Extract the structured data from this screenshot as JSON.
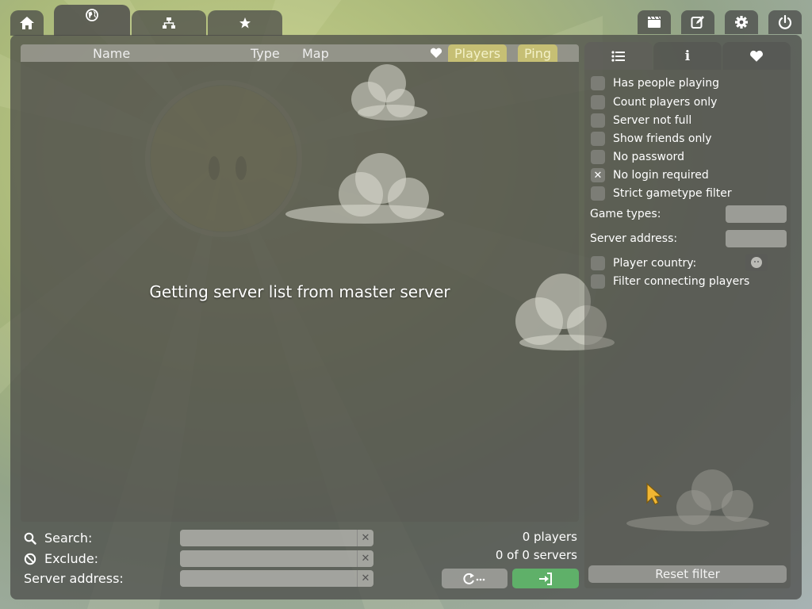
{
  "top_tabs": [
    {
      "icon": "home-icon"
    },
    {
      "icon": "globe-icon",
      "active": true
    },
    {
      "icon": "network-icon"
    },
    {
      "icon": "star-icon"
    }
  ],
  "toolbar_buttons": [
    {
      "icon": "clapperboard-icon"
    },
    {
      "icon": "edit-icon"
    },
    {
      "icon": "gear-icon"
    },
    {
      "icon": "power-icon"
    }
  ],
  "list_header": {
    "name": "Name",
    "type": "Type",
    "map": "Map",
    "favorite_icon": "heart-icon",
    "players": "Players",
    "ping": "Ping"
  },
  "status_message": "Getting server list from master server",
  "filter_tabs": [
    {
      "icon": "list-icon",
      "active": true
    },
    {
      "icon": "info-icon"
    },
    {
      "icon": "heart-icon"
    }
  ],
  "filters": {
    "checkboxes": [
      {
        "label": "Has people playing",
        "checked": false
      },
      {
        "label": "Count players only",
        "checked": false
      },
      {
        "label": "Server not full",
        "checked": false
      },
      {
        "label": "Show friends only",
        "checked": false
      },
      {
        "label": "No password",
        "checked": false
      },
      {
        "label": "No login required",
        "checked": true
      },
      {
        "label": "Strict gametype filter",
        "checked": false
      }
    ],
    "game_types_label": "Game types:",
    "game_types_value": "",
    "server_address_label": "Server address:",
    "server_address_value": "",
    "player_country_label": "Player country:",
    "player_country_checked": false,
    "filter_connecting_label": "Filter connecting players",
    "filter_connecting_checked": false,
    "reset_label": "Reset filter"
  },
  "bottom": {
    "search_label": "Search:",
    "search_value": "",
    "exclude_label": "Exclude:",
    "exclude_value": "",
    "server_address_label": "Server address:",
    "server_address_value": "",
    "players_count": "0 players",
    "servers_count": "0 of 0 servers"
  },
  "colors": {
    "accent_sorted": "#d7cd6e",
    "connect_green": "#5fb069"
  }
}
